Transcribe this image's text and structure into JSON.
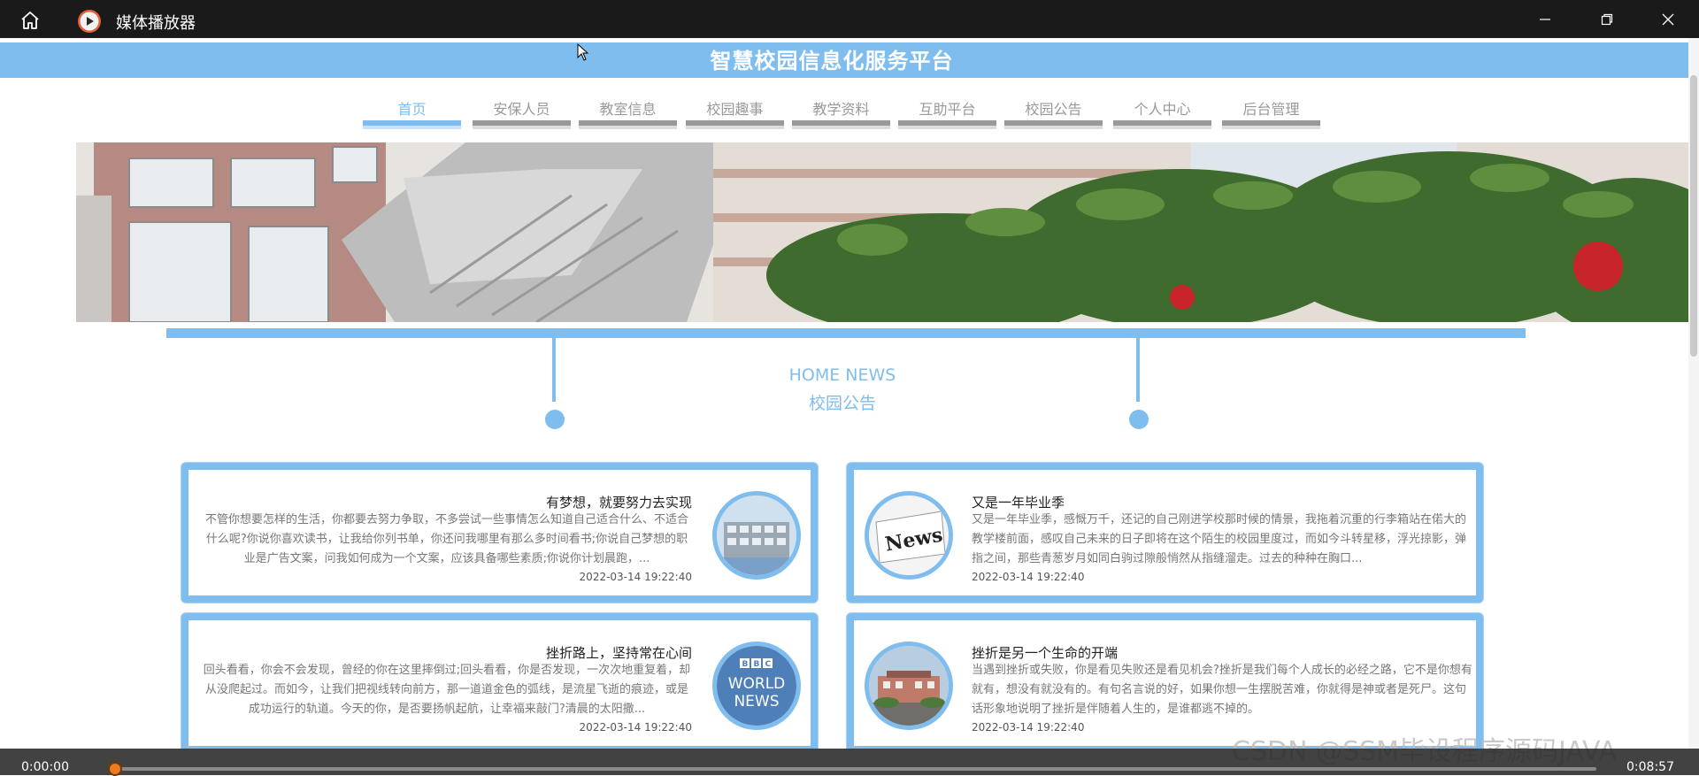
{
  "window": {
    "title": "媒体播放器",
    "icons": {
      "home": "home-icon",
      "app": "play-icon",
      "minimize": "minimize-icon",
      "maximize": "restore-icon",
      "close": "close-icon"
    }
  },
  "site": {
    "title": "智慧校园信息化服务平台",
    "nav": [
      {
        "label": "首页",
        "active": true
      },
      {
        "label": "安保人员",
        "active": false
      },
      {
        "label": "教室信息",
        "active": false
      },
      {
        "label": "校园趣事",
        "active": false
      },
      {
        "label": "教学资料",
        "active": false
      },
      {
        "label": "互助平台",
        "active": false
      },
      {
        "label": "校园公告",
        "active": false
      },
      {
        "label": "个人中心",
        "active": false
      },
      {
        "label": "后台管理",
        "active": false
      }
    ],
    "section": {
      "en": "HOME NEWS",
      "cn": "校园公告"
    },
    "news": [
      {
        "title": "有梦想，就要努力去实现",
        "summary": "不管你想要怎样的生活，你都要去努力争取，不多尝试一些事情怎么知道自己适合什么、不适合什么呢?你说你喜欢读书，让我给你列书单，你还问我哪里有那么多时间看书;你说自己梦想的职业是广告文案，问我如何成为一个文案，应该具备哪些素质;你说你计划晨跑，...",
        "date": "2022-03-14 19:22:40",
        "image": "school-building-image"
      },
      {
        "title": "又是一年毕业季",
        "summary": "又是一年毕业季，感慨万千，还记的自己刚进学校那时候的情景，我拖着沉重的行李箱站在偌大的教学楼前面，感叹自己未来的日子即将在这个陌生的校园里度过，而如今斗转星移，浮光掠影，弹指之间，那些青葱岁月如同白驹过隙般悄然从指缝溜走。过去的种种在胸口...",
        "date": "2022-03-14 19:22:40",
        "image": "news-newspaper-image"
      },
      {
        "title": "挫折路上，坚持常在心间",
        "summary": "回头看看，你会不会发现，曾经的你在这里摔倒过;回头看看，你是否发现，一次次地重复着，却从没爬起过。而如今，让我们把视线转向前方，那一道道金色的弧线，是流星飞逝的痕迹，或是成功运行的轨道。今天的你，是否要扬帆起航，让幸福来敲门?清晨的太阳撒...",
        "date": "2022-03-14 19:22:40",
        "image": "bbc-world-news-image"
      },
      {
        "title": "挫折是另一个生命的开端",
        "summary": "当遇到挫折或失败，你是看见失败还是看见机会?挫折是我们每个人成长的必经之路，它不是你想有就有，想没有就没有的。有句名言说的好，如果你想一生摆脱苦难，你就得是神或者是死尸。这句话形象地说明了挫折是伴随着人生的，是谁都逃不掉的。",
        "date": "2022-03-14 19:22:40",
        "image": "campus-gate-image"
      }
    ]
  },
  "watermark": "CSDN @SSM毕设程序源码JAVA",
  "player": {
    "current_time": "0:00:00",
    "duration": "0:08:57",
    "progress": 0.0
  },
  "colors": {
    "accent": "#7fbdef",
    "titlebar": "#1a1a1a",
    "progress_knob": "#f07c21"
  }
}
